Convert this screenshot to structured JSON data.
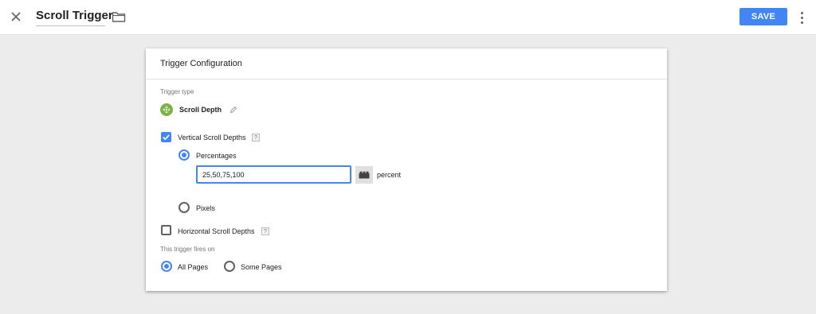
{
  "header": {
    "title": "Scroll Trigger",
    "save_label": "SAVE",
    "icons": {
      "close": "close-icon",
      "folder": "folder-icon",
      "more": "more-vert-icon"
    },
    "accent_color": "#4285f4"
  },
  "card": {
    "title": "Trigger Configuration",
    "trigger_type_label": "Trigger type",
    "trigger_type": {
      "name": "Scroll Depth",
      "icon": "scroll-depth-icon",
      "icon_color": "#7cb342"
    },
    "vertical": {
      "label": "Vertical Scroll Depths",
      "checked": true,
      "help": "?",
      "options": {
        "percentages": {
          "label": "Percentages",
          "selected": true
        },
        "pixels": {
          "label": "Pixels",
          "selected": false
        }
      },
      "input_value": "25,50,75,100",
      "unit": "percent"
    },
    "horizontal": {
      "label": "Horizontal Scroll Depths",
      "checked": false,
      "help": "?"
    },
    "fires_on": {
      "label": "This trigger fires on",
      "all_pages": {
        "label": "All Pages",
        "selected": true
      },
      "some_pages": {
        "label": "Some Pages",
        "selected": false
      }
    }
  }
}
